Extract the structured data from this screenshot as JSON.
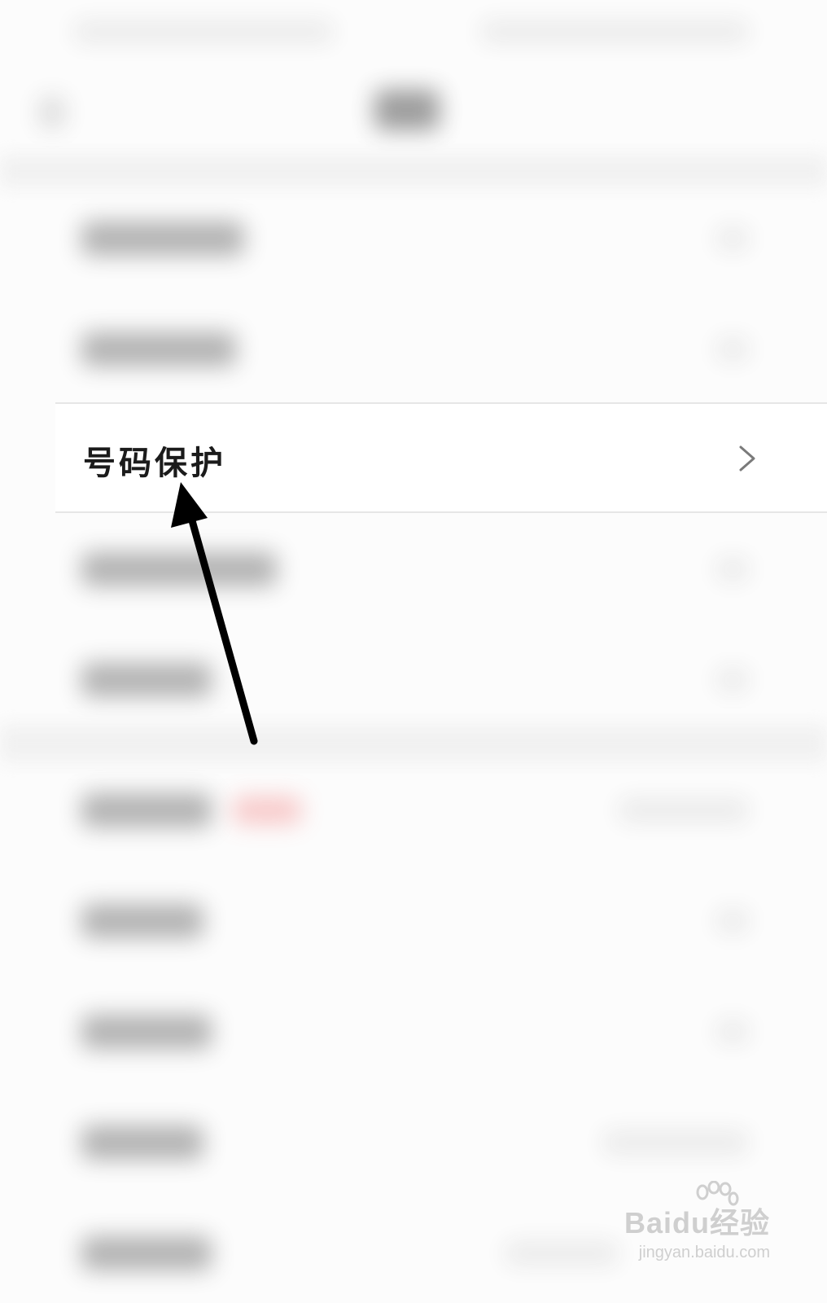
{
  "highlighted_row": {
    "label": "号码保护"
  },
  "watermark": {
    "brand": "Baidu经验",
    "url": "jingyan.baidu.com"
  },
  "colors": {
    "annotation_arrow": "#000000",
    "chevron": "#7a7a7a",
    "badge": "#f06a6a"
  },
  "icons": {
    "row_chevron": "chevron-right-icon",
    "arrow": "annotation-arrow-icon"
  }
}
